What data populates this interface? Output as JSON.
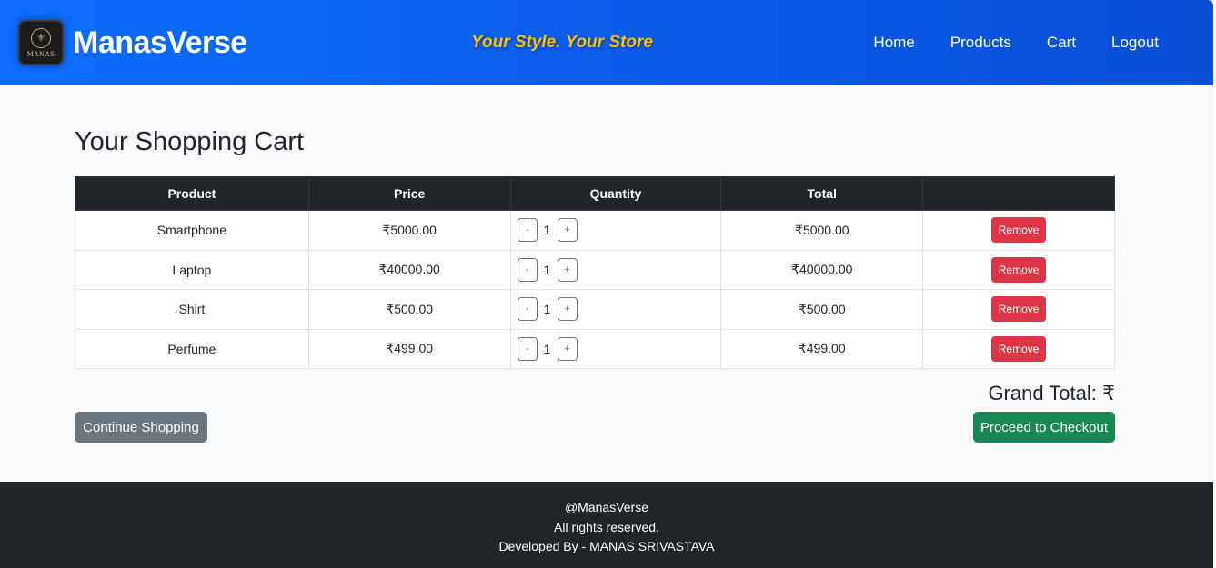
{
  "brand": {
    "logo_text": "MANAS",
    "name": "ManasVerse",
    "tagline": "Your Style. Your Store"
  },
  "nav": {
    "items": [
      "Home",
      "Products",
      "Cart",
      "Logout"
    ]
  },
  "page": {
    "title": "Your Shopping Cart"
  },
  "cart": {
    "headers": [
      "Product",
      "Price",
      "Quantity",
      "Total",
      ""
    ],
    "rows": [
      {
        "product": "Smartphone",
        "price": "₹5000.00",
        "quantity": "1",
        "total": "₹5000.00",
        "remove_label": "Remove"
      },
      {
        "product": "Laptop",
        "price": "₹40000.00",
        "quantity": "1",
        "total": "₹40000.00",
        "remove_label": "Remove"
      },
      {
        "product": "Shirt",
        "price": "₹500.00",
        "quantity": "1",
        "total": "₹500.00",
        "remove_label": "Remove"
      },
      {
        "product": "Perfume",
        "price": "₹499.00",
        "quantity": "1",
        "total": "₹499.00",
        "remove_label": "Remove"
      }
    ],
    "decrement_label": "-",
    "increment_label": "+",
    "grand_total": "Grand Total: ₹"
  },
  "actions": {
    "continue_label": "Continue Shopping",
    "checkout_label": "Proceed to Checkout"
  },
  "footer": {
    "line1": "@ManasVerse",
    "line2": "All rights reserved.",
    "line3": "Developed By - MANAS SRIVASTAVA"
  },
  "colors": {
    "navbar": "#0d6efd",
    "tagline": "#ffc107",
    "table_header": "#212529",
    "remove": "#dc3545",
    "continue": "#6c757d",
    "checkout": "#198754",
    "footer": "#212529"
  }
}
